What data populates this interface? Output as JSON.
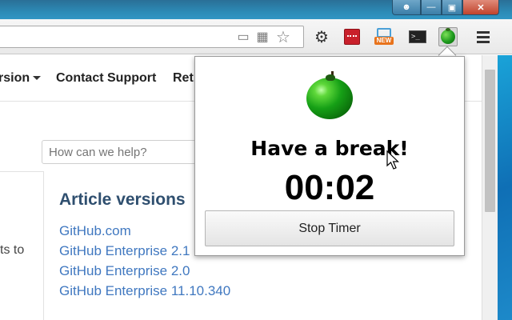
{
  "window": {
    "controls": [
      "user",
      "minimize",
      "maximize",
      "close"
    ]
  },
  "toolbar": {
    "omnibox_icons": [
      "devices-icon",
      "translate-icon",
      "star-icon"
    ],
    "extensions": [
      "gear-icon",
      "red-extension-icon",
      "screenshot-new-icon",
      "terminal-icon",
      "tomato-timer-icon",
      "menu-icon"
    ],
    "new_badge": "NEW"
  },
  "page": {
    "nav": {
      "version_label": "rsion",
      "contact_label": "Contact Support",
      "partial_label": "Ret"
    },
    "search": {
      "placeholder": "How can we help?"
    },
    "left_snippet": "ts to",
    "article": {
      "title": "Article versions",
      "links": [
        "GitHub.com",
        "GitHub Enterprise 2.1",
        "GitHub Enterprise 2.0",
        "GitHub Enterprise 11.10.340"
      ]
    }
  },
  "popup": {
    "message": "Have a break!",
    "timer": "00:02",
    "stop_label": "Stop Timer"
  },
  "colors": {
    "link": "#4078c0",
    "article_title": "#2f4f6f",
    "titlebar": "#2c8ab5",
    "tomato": "#16a016"
  }
}
